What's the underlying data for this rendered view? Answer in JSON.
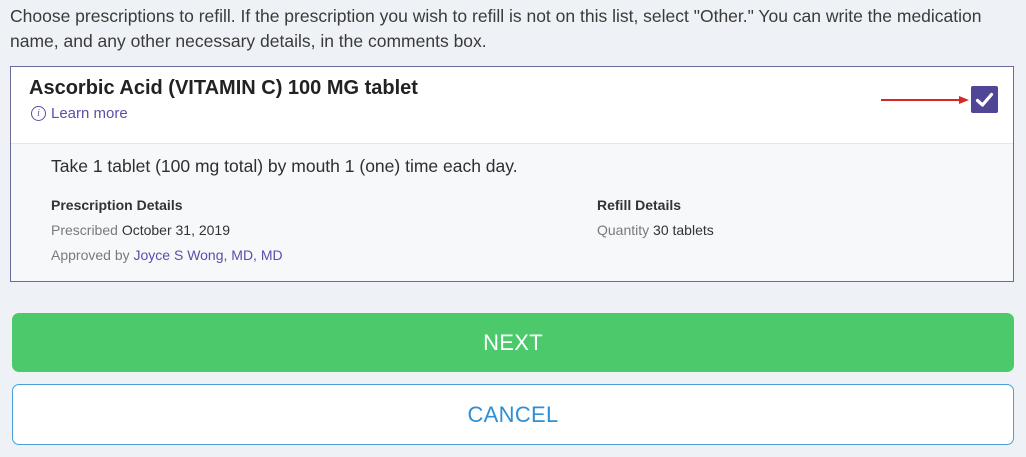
{
  "instructions": "Choose prescriptions to refill.  If the prescription you wish to refill is not on this list, select \"Other.\" You can write the medication name, and any other necessary details, in the comments box.",
  "prescription": {
    "name": "Ascorbic Acid (VITAMIN C) 100 MG tablet",
    "learn_more": "Learn more",
    "learn_more_icon": "info-icon",
    "selected": true,
    "sig": "Take 1 tablet (100 mg total) by mouth 1 (one) time each day.",
    "prescription_details": {
      "heading": "Prescription Details",
      "prescribed_label": "Prescribed",
      "prescribed_value": "October 31, 2019",
      "approved_label": "Approved by",
      "approved_value": "Joyce S Wong, MD, MD"
    },
    "refill_details": {
      "heading": "Refill Details",
      "quantity_label": "Quantity",
      "quantity_value": "30 tablets"
    }
  },
  "buttons": {
    "next": "NEXT",
    "cancel": "CANCEL"
  },
  "colors": {
    "accent_purple": "#4f4696",
    "link": "#5b4ea8",
    "next_green": "#4cca6b",
    "cancel_blue": "#2e8fd6",
    "arrow_red": "#d62828"
  }
}
